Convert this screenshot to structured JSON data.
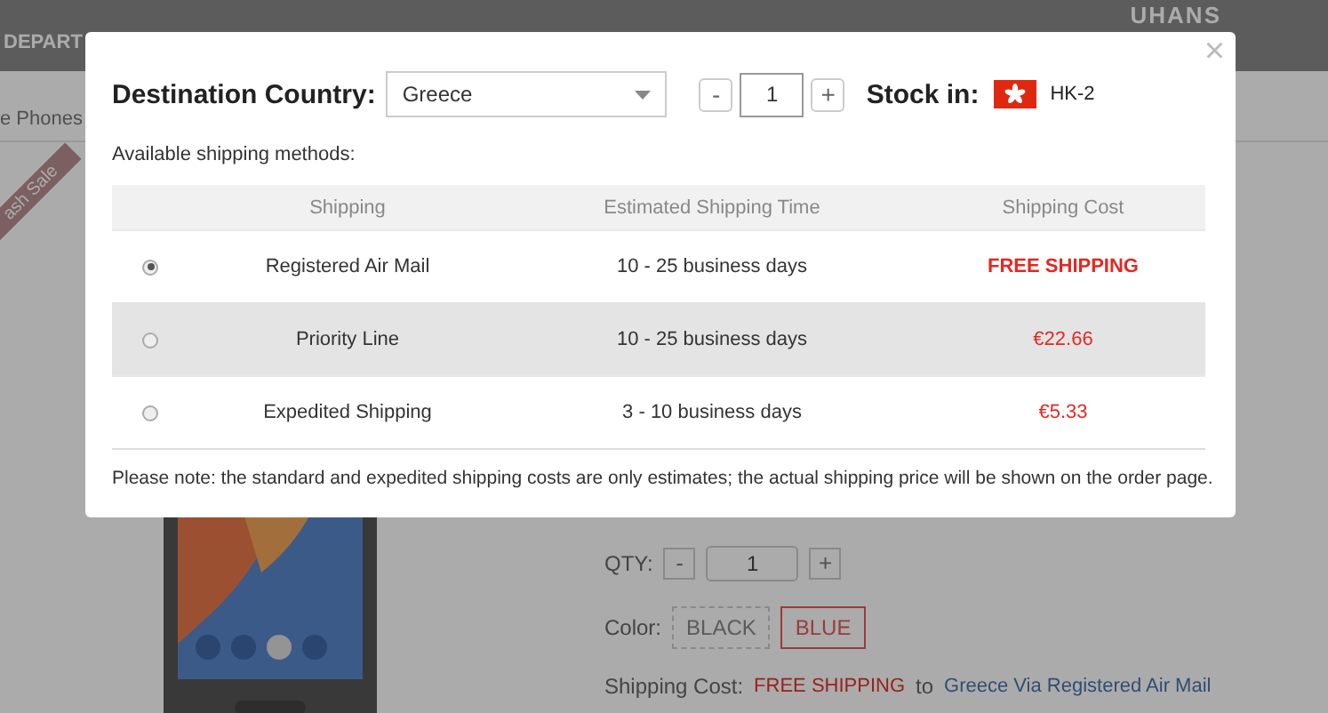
{
  "background": {
    "nav_label": "DEPART",
    "logo": "UHANS",
    "breadcrumb": "e Phones",
    "ribbon": "ash Sale",
    "qty_label": "QTY:",
    "qty_minus": "-",
    "qty_value": "1",
    "qty_plus": "+",
    "color_label": "Color:",
    "colors": [
      {
        "label": "BLACK",
        "selected": false
      },
      {
        "label": "BLUE",
        "selected": true
      }
    ],
    "shipping_label": "Shipping Cost:",
    "shipping_free": "FREE SHIPPING",
    "shipping_to": "to",
    "shipping_method": "Greece Via Registered Air Mail"
  },
  "dialog": {
    "close": "×",
    "country_label": "Destination Country:",
    "country": "Greece",
    "minus": "-",
    "quantity": "1",
    "plus": "+",
    "stock_label": "Stock in:",
    "stock_location": "HK-2",
    "methods_label": "Available shipping methods:",
    "columns": [
      "Shipping",
      "Estimated Shipping Time",
      "Shipping Cost"
    ],
    "rows": [
      {
        "selected": true,
        "highlighted": false,
        "name": "Registered Air Mail",
        "time": "10 - 25 business days",
        "cost": "FREE SHIPPING",
        "kind": "free"
      },
      {
        "selected": false,
        "highlighted": true,
        "name": "Priority Line",
        "time": "10 - 25 business days",
        "cost": "€22.66",
        "kind": "price"
      },
      {
        "selected": false,
        "highlighted": false,
        "name": "Expedited Shipping",
        "time": "3 - 10 business days",
        "cost": "€5.33",
        "kind": "price"
      }
    ],
    "note": "Please note: the standard and expedited shipping costs are only estimates; the actual shipping price will be shown on the order page."
  }
}
